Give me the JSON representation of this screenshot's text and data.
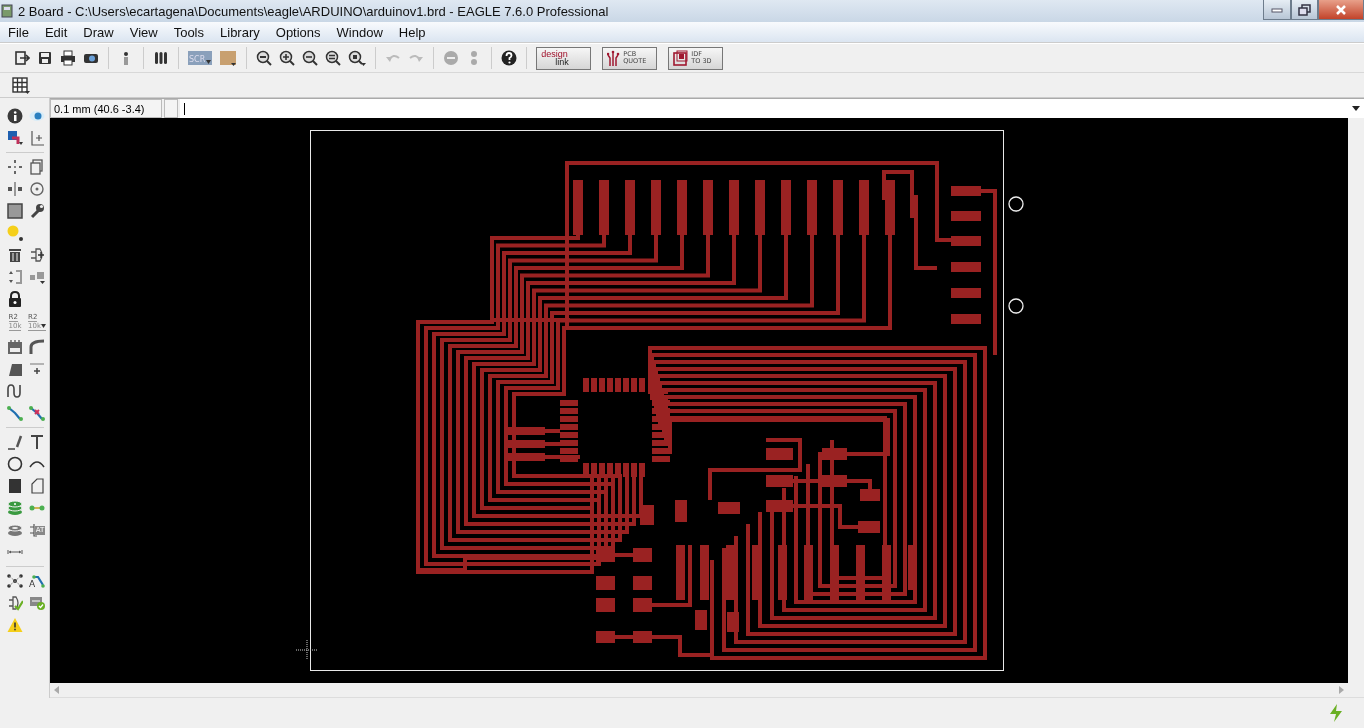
{
  "window": {
    "title": "2 Board - C:\\Users\\ecartagena\\Documents\\eagle\\ARDUINO\\arduinov1.brd - EAGLE 7.6.0 Professional"
  },
  "menu": [
    "File",
    "Edit",
    "Draw",
    "View",
    "Tools",
    "Library",
    "Options",
    "Window",
    "Help"
  ],
  "toolbar": {
    "script_label": "SCR",
    "links": [
      {
        "line1": "design",
        "line2": "link"
      },
      {
        "line1": "PCB",
        "line2": "QUOTE"
      },
      {
        "line1": "IDF",
        "line2": "TO 3D"
      }
    ]
  },
  "command_line": {
    "coordinates": "0.1 mm (40.6 -3.4)"
  },
  "side_tools": {
    "name_labels": [
      {
        "name": "R2",
        "value": "10k"
      },
      {
        "name": "R2",
        "value": "10k"
      }
    ],
    "attribute_label": "AT",
    "autoroute_label": "A"
  }
}
